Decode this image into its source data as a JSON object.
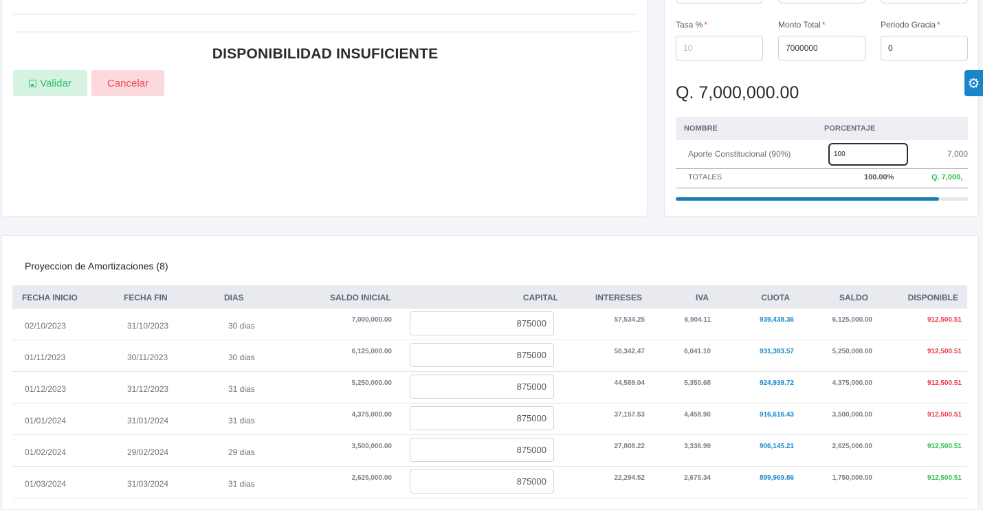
{
  "left": {
    "status_title": "DISPONIBILIDAD INSUFICIENTE",
    "validar_label": "Validar",
    "cancelar_label": "Cancelar"
  },
  "form": {
    "tasa_label": "Tasa %",
    "tasa_placeholder": "10",
    "monto_label": "Monto Total",
    "monto_value": "7000000",
    "gracia_label": "Periodo Gracia",
    "gracia_value": "0",
    "required_mark": "*"
  },
  "summary": {
    "amount": "Q. 7,000,000.00",
    "col_nombre": "NOMBRE",
    "col_porcentaje": "PORCENTAJE",
    "row_name": "Aporte Constitucional (90%)",
    "row_pct": "100",
    "row_amount": "7,000",
    "totales_label": "TOTALES",
    "totales_pct": "100.00%",
    "totales_amount": "Q. 7,000,",
    "progress_fraction": 0.9
  },
  "table": {
    "title": "Proyeccion de Amortizaciones (8)",
    "headers": [
      "FECHA INICIO",
      "FECHA FIN",
      "DIAS",
      "SALDO INICIAL",
      "CAPITAL",
      "INTERESES",
      "IVA",
      "CUOTA",
      "SALDO",
      "DISPONIBLE"
    ],
    "rows": [
      {
        "inicio": "02/10/2023",
        "fin": "31/10/2023",
        "dias": "30 dias",
        "saldo_inicial": "7,000,000.00",
        "capital": "875000",
        "intereses": "57,534.25",
        "iva": "6,904.11",
        "cuota": "939,438.36",
        "saldo": "6,125,000.00",
        "disponible": "912,500.51",
        "disp_status": "red"
      },
      {
        "inicio": "01/11/2023",
        "fin": "30/11/2023",
        "dias": "30 dias",
        "saldo_inicial": "6,125,000.00",
        "capital": "875000",
        "intereses": "50,342.47",
        "iva": "6,041.10",
        "cuota": "931,383.57",
        "saldo": "5,250,000.00",
        "disponible": "912,500.51",
        "disp_status": "red"
      },
      {
        "inicio": "01/12/2023",
        "fin": "31/12/2023",
        "dias": "31 dias",
        "saldo_inicial": "5,250,000.00",
        "capital": "875000",
        "intereses": "44,589.04",
        "iva": "5,350.68",
        "cuota": "924,939.72",
        "saldo": "4,375,000.00",
        "disponible": "912,500.51",
        "disp_status": "red"
      },
      {
        "inicio": "01/01/2024",
        "fin": "31/01/2024",
        "dias": "31 dias",
        "saldo_inicial": "4,375,000.00",
        "capital": "875000",
        "intereses": "37,157.53",
        "iva": "4,458.90",
        "cuota": "916,616.43",
        "saldo": "3,500,000.00",
        "disponible": "912,500.51",
        "disp_status": "red"
      },
      {
        "inicio": "01/02/2024",
        "fin": "29/02/2024",
        "dias": "29 dias",
        "saldo_inicial": "3,500,000.00",
        "capital": "875000",
        "intereses": "27,808.22",
        "iva": "3,336.99",
        "cuota": "906,145.21",
        "saldo": "2,625,000.00",
        "disponible": "912,500.51",
        "disp_status": "green"
      },
      {
        "inicio": "01/03/2024",
        "fin": "31/03/2024",
        "dias": "31 dias",
        "saldo_inicial": "2,625,000.00",
        "capital": "875000",
        "intereses": "22,294.52",
        "iva": "2,675.34",
        "cuota": "899,969.86",
        "saldo": "1,750,000.00",
        "disponible": "912,500.51",
        "disp_status": "green"
      }
    ]
  },
  "colors": {
    "accent_blue": "#1a88c9",
    "danger_red": "#ee3b4a",
    "success_green": "#2fbf4a"
  },
  "icons": {
    "save": "save-icon",
    "gear": "gear-icon"
  }
}
